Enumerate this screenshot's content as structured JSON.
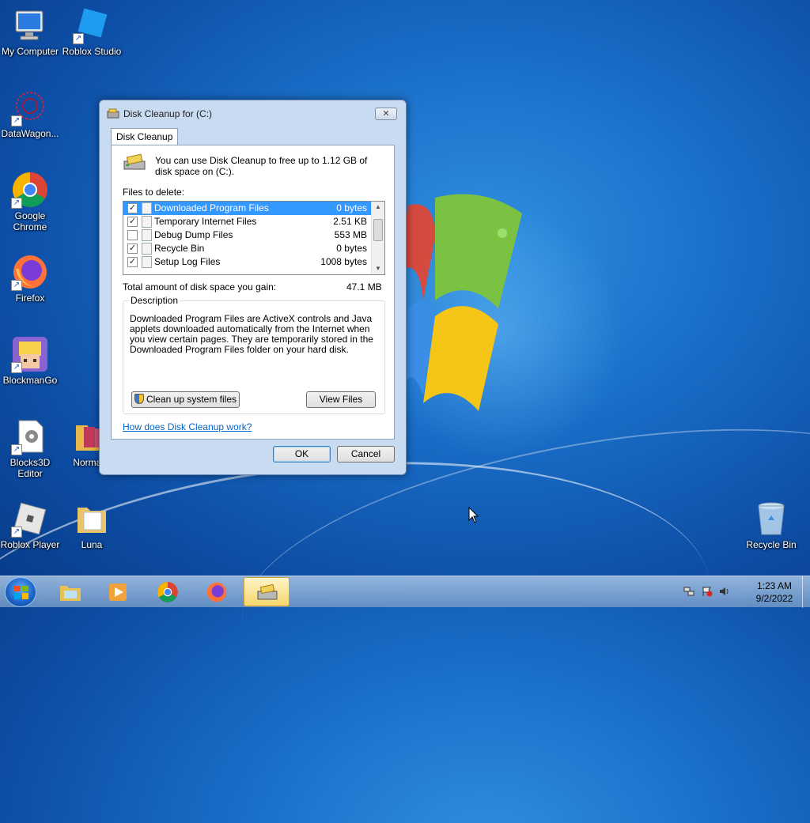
{
  "desktop": {
    "icons": [
      {
        "label": "My Computer"
      },
      {
        "label": "Roblox Studio"
      },
      {
        "label": "DataWagon..."
      },
      {
        "label": "Google Chrome"
      },
      {
        "label": "Firefox"
      },
      {
        "label": "BlockmanGo"
      },
      {
        "label": "Blocks3D Editor"
      },
      {
        "label": "NormalC"
      },
      {
        "label": "Roblox Player"
      },
      {
        "label": "Luna"
      },
      {
        "label": "Recycle Bin"
      }
    ]
  },
  "dialog": {
    "title": "Disk Cleanup for  (C:)",
    "close_glyph": "✕",
    "tab": "Disk Cleanup",
    "intro": "You can use Disk Cleanup to free up to 1.12 GB of disk space on  (C:).",
    "files_label": "Files to delete:",
    "files": [
      {
        "name": "Downloaded Program Files",
        "size": "0 bytes",
        "checked": true,
        "selected": true
      },
      {
        "name": "Temporary Internet Files",
        "size": "2.51 KB",
        "checked": true,
        "selected": false
      },
      {
        "name": "Debug Dump Files",
        "size": "553 MB",
        "checked": false,
        "selected": false
      },
      {
        "name": "Recycle Bin",
        "size": "0 bytes",
        "checked": true,
        "selected": false
      },
      {
        "name": "Setup Log Files",
        "size": "1008 bytes",
        "checked": true,
        "selected": false
      }
    ],
    "total_label": "Total amount of disk space you gain:",
    "total_value": "47.1 MB",
    "description_legend": "Description",
    "description": "Downloaded Program Files are ActiveX controls and Java applets downloaded automatically from the Internet when you view certain pages. They are temporarily stored in the Downloaded Program Files folder on your hard disk.",
    "cleanup_system_label": "Clean up system files",
    "view_files_label": "View Files",
    "help_link": "How does Disk Cleanup work?",
    "ok_label": "OK",
    "cancel_label": "Cancel"
  },
  "taskbar": {
    "items": [
      "explorer",
      "media-player",
      "chrome",
      "firefox",
      "disk-cleanup"
    ],
    "time": "1:23 AM",
    "date": "9/2/2022"
  }
}
